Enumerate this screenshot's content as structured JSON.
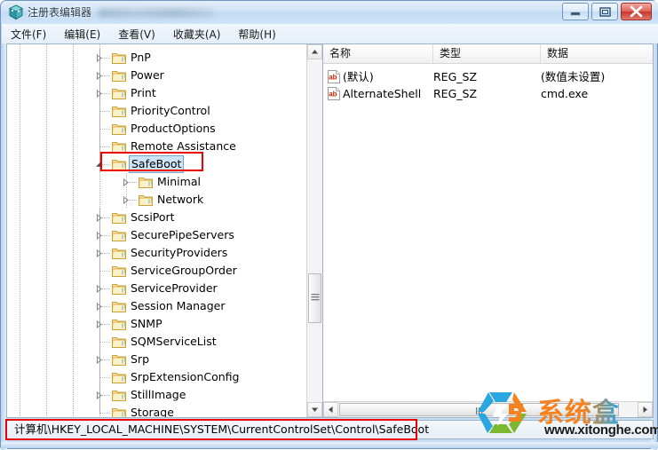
{
  "window": {
    "title": "注册表编辑器",
    "icon": "registry-editor-icon",
    "controls": {
      "minimize": "minimize-icon",
      "maximize": "maximize-icon",
      "close": "close-icon"
    }
  },
  "menubar": {
    "items": [
      {
        "label": "文件(F)"
      },
      {
        "label": "编辑(E)"
      },
      {
        "label": "查看(V)"
      },
      {
        "label": "收藏夹(A)"
      },
      {
        "label": "帮助(H)"
      }
    ]
  },
  "tree": {
    "nodes": [
      {
        "label": "PnP",
        "depth": 0,
        "expander": "collapsed",
        "selected": false
      },
      {
        "label": "Power",
        "depth": 0,
        "expander": "collapsed",
        "selected": false
      },
      {
        "label": "Print",
        "depth": 0,
        "expander": "collapsed",
        "selected": false
      },
      {
        "label": "PriorityControl",
        "depth": 0,
        "expander": "none",
        "selected": false
      },
      {
        "label": "ProductOptions",
        "depth": 0,
        "expander": "none",
        "selected": false
      },
      {
        "label": "Remote Assistance",
        "depth": 0,
        "expander": "none",
        "selected": false
      },
      {
        "label": "SafeBoot",
        "depth": 0,
        "expander": "expanded",
        "selected": true
      },
      {
        "label": "Minimal",
        "depth": 1,
        "expander": "collapsed",
        "selected": false
      },
      {
        "label": "Network",
        "depth": 1,
        "expander": "collapsed",
        "selected": false
      },
      {
        "label": "ScsiPort",
        "depth": 0,
        "expander": "collapsed",
        "selected": false
      },
      {
        "label": "SecurePipeServers",
        "depth": 0,
        "expander": "collapsed",
        "selected": false
      },
      {
        "label": "SecurityProviders",
        "depth": 0,
        "expander": "collapsed",
        "selected": false
      },
      {
        "label": "ServiceGroupOrder",
        "depth": 0,
        "expander": "none",
        "selected": false
      },
      {
        "label": "ServiceProvider",
        "depth": 0,
        "expander": "collapsed",
        "selected": false
      },
      {
        "label": "Session Manager",
        "depth": 0,
        "expander": "collapsed",
        "selected": false
      },
      {
        "label": "SNMP",
        "depth": 0,
        "expander": "collapsed",
        "selected": false
      },
      {
        "label": "SQMServiceList",
        "depth": 0,
        "expander": "none",
        "selected": false
      },
      {
        "label": "Srp",
        "depth": 0,
        "expander": "collapsed",
        "selected": false
      },
      {
        "label": "SrpExtensionConfig",
        "depth": 0,
        "expander": "none",
        "selected": false
      },
      {
        "label": "StillImage",
        "depth": 0,
        "expander": "collapsed",
        "selected": false
      },
      {
        "label": "Storage",
        "depth": 0,
        "expander": "none",
        "selected": false
      }
    ],
    "scrollbar": {
      "up": "scroll-up-arrow",
      "down": "scroll-down-arrow"
    }
  },
  "list": {
    "columns": [
      {
        "label": "名称"
      },
      {
        "label": "类型"
      },
      {
        "label": "数据"
      }
    ],
    "rows": [
      {
        "name": "(默认)",
        "type": "REG_SZ",
        "data": "(数值未设置)",
        "icon": "string-value-icon"
      },
      {
        "name": "AlternateShell",
        "type": "REG_SZ",
        "data": "cmd.exe",
        "icon": "string-value-icon"
      }
    ],
    "scrollbar": {
      "left": "scroll-left-arrow",
      "right": "scroll-right-arrow"
    }
  },
  "statusbar": {
    "path": "计算机\\HKEY_LOCAL_MACHINE\\SYSTEM\\CurrentControlSet\\Control\\SafeBoot"
  },
  "annotations": [
    {
      "name": "safeboot-highlight-box",
      "color": "#ee0000"
    },
    {
      "name": "status-path-highlight-box",
      "color": "#ee0000"
    }
  ],
  "watermark": {
    "brand": "系统盒",
    "url": "www.xitonghe.com",
    "colors": {
      "blue": "#2aa7e0",
      "orange": "#f5821f",
      "green": "#7cb82f"
    }
  }
}
